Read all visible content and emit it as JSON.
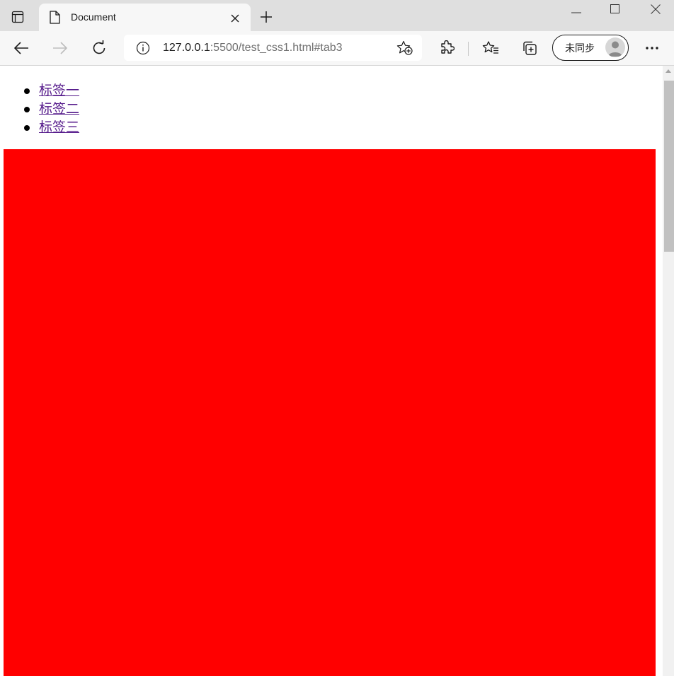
{
  "tab": {
    "title": "Document",
    "favicon": "document-icon"
  },
  "toolbar": {
    "url_host": "127.0.0.1",
    "url_rest": ":5500/test_css1.html#tab3",
    "profile_label": "未同步"
  },
  "page": {
    "links": [
      {
        "label": "标签一"
      },
      {
        "label": "标签二"
      },
      {
        "label": "标签三"
      }
    ],
    "content_color": "#ff0000"
  },
  "colors": {
    "tabstrip_bg": "#dfdfdf",
    "toolbar_bg": "#f7f7f7",
    "visited_link": "#551a8b",
    "red_box": "#ff0000"
  },
  "icons": [
    "tab-actions-icon",
    "document-icon",
    "close-icon",
    "plus-icon",
    "minimize-icon",
    "maximize-icon",
    "window-close-icon",
    "back-arrow-icon",
    "forward-arrow-icon",
    "refresh-icon",
    "info-icon",
    "favorite-add-icon",
    "extensions-icon",
    "favorites-icon",
    "collections-icon",
    "avatar",
    "more-icon"
  ]
}
